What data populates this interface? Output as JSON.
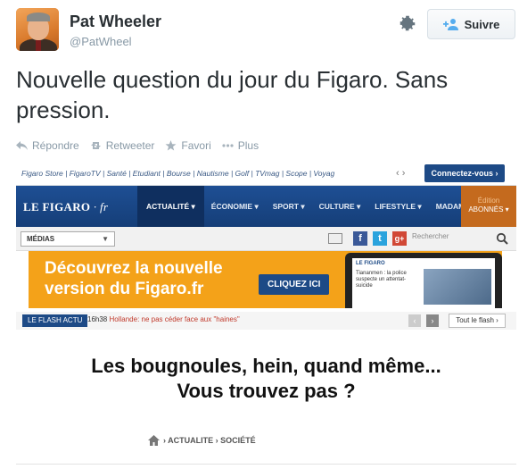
{
  "tweet": {
    "user_name": "Pat Wheeler",
    "handle": "@PatWheel",
    "follow_label": "Suivre",
    "text": "Nouvelle question du jour du Figaro. Sans pression.",
    "actions": [
      {
        "icon": "reply-icon",
        "label": "Répondre"
      },
      {
        "icon": "retweet-icon",
        "label": "Retweeter"
      },
      {
        "icon": "star-icon",
        "label": "Favori"
      },
      {
        "icon": "more-icon",
        "label": "Plus"
      }
    ]
  },
  "figaro": {
    "top_links": "Figaro Store | FigaroTV | Santé | Etudiant | Bourse | Nautisme | Golf | TVmag | Scope | Voyag",
    "connect_label": "Connectez-vous ›",
    "logo_main": "LE FIGARO",
    "logo_suffix": "· fr",
    "nav": [
      "ACTUALITÉ ▾",
      "ÉCONOMIE ▾",
      "SPORT ▾",
      "CULTURE ▾",
      "LIFESTYLE ▾",
      "MADAME ▾"
    ],
    "edition_label": "Édition",
    "edition_value": "ABONNÉS ▾",
    "medias_label": "MÉDIAS",
    "search_placeholder": "Rechercher",
    "banner_text_line1": "Découvrez la nouvelle",
    "banner_text_line2": "version du Figaro.fr",
    "banner_cta": "CLIQUEZ ICI",
    "tablet_logo": "LE FIGARO",
    "tablet_headline": "Tiananmen : la police suspecte un attentat-suicide",
    "flash_label": "LE FLASH ACTU",
    "flash_time": "16h38",
    "flash_text": "Hollande: ne pas céder face aux \"haines\"",
    "tout_flash": "Tout le flash ›",
    "headline_line1": "Les bougnoules, hein, quand même...",
    "headline_line2": "Vous trouvez pas ?",
    "breadcrumb": "› ACTUALITE › SOCIÉTÉ"
  },
  "colors": {
    "figaro_blue": "#1d4a86",
    "banner_orange": "#f4a219",
    "twitter_gray": "#8899a6"
  }
}
